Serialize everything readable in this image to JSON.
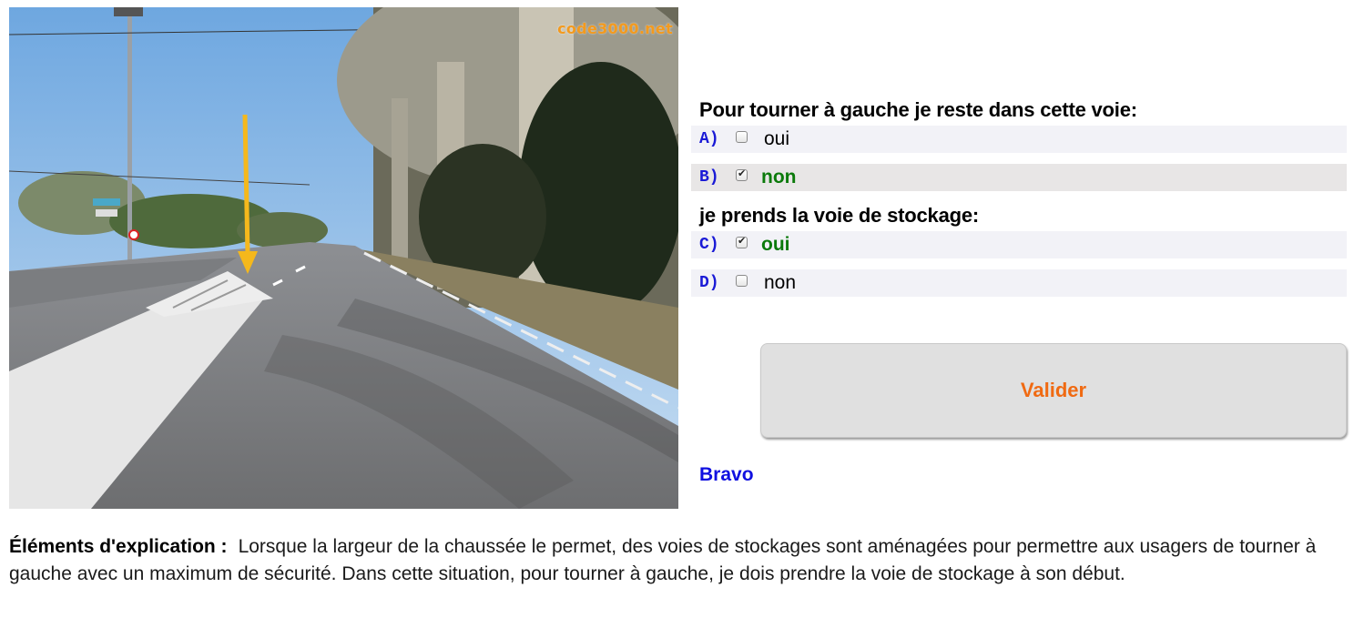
{
  "scene": {
    "watermark": "code3000.net",
    "alt": "Route avec voie de stockage pour tourner à gauche"
  },
  "quiz": {
    "question1": "Pour tourner à gauche je reste dans cette voie:",
    "question2": "je prends la voie de stockage:",
    "answers": [
      {
        "letter": "A)",
        "text": "oui",
        "checked": false,
        "correct": false
      },
      {
        "letter": "B)",
        "text": "non",
        "checked": true,
        "correct": true
      },
      {
        "letter": "C)",
        "text": "oui",
        "checked": true,
        "correct": true
      },
      {
        "letter": "D)",
        "text": "non",
        "checked": false,
        "correct": false
      }
    ],
    "validate_label": "Valider",
    "feedback": "Bravo"
  },
  "explanation": {
    "lead": "Éléments d'explication :",
    "text": "Lorsque la largeur de la chaussée le permet, des voies de stockages sont aménagées pour permettre aux usagers de tourner à gauche avec un maximum de sécurité. Dans cette situation, pour tourner à gauche, je dois prendre la voie de stockage à son début."
  },
  "colors": {
    "letter": "#1a1ad6",
    "correct": "#0b7a0b",
    "validate_text": "#f06a12",
    "feedback": "#1010e0",
    "arrow": "#f5b81c"
  }
}
